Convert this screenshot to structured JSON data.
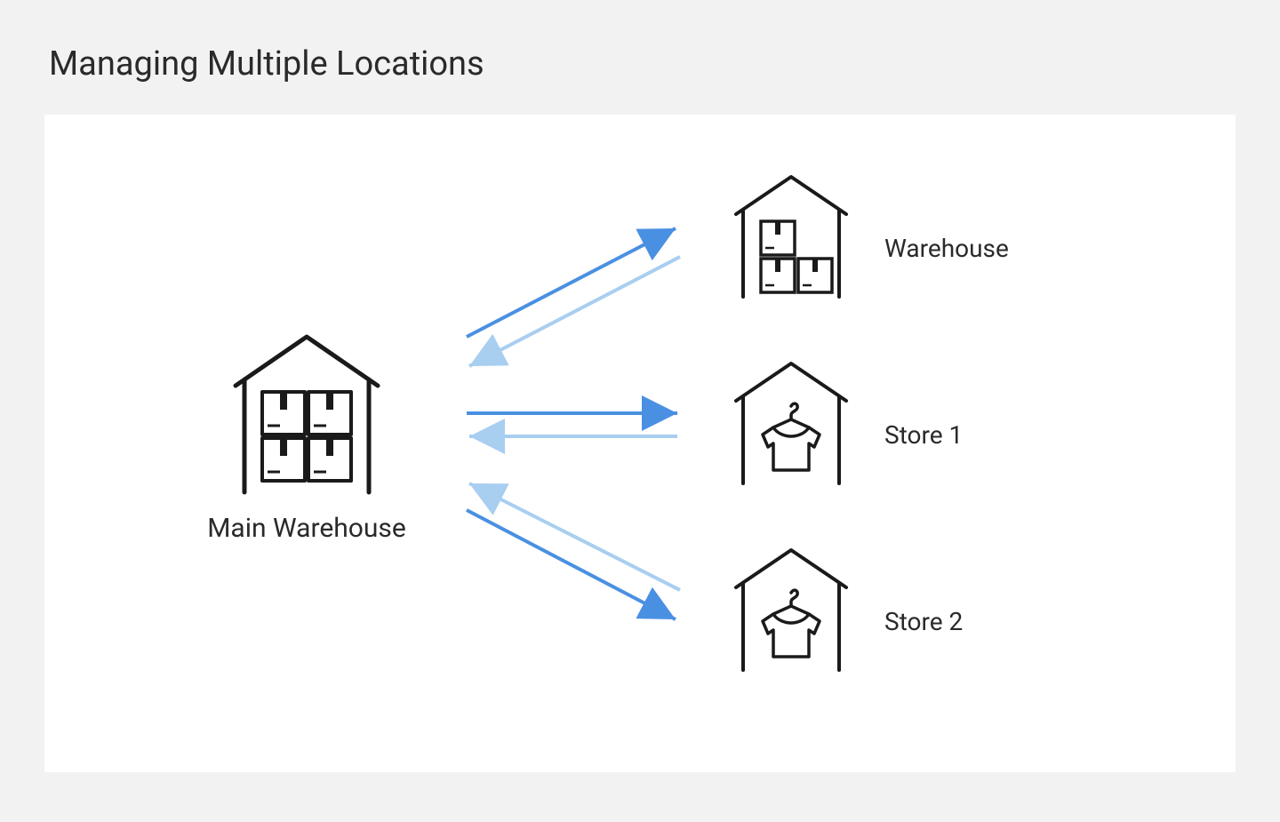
{
  "title": "Managing Multiple Locations",
  "nodes": {
    "main": {
      "label": "Main Warehouse"
    },
    "warehouse": {
      "label": "Warehouse"
    },
    "store1": {
      "label": "Store 1"
    },
    "store2": {
      "label": "Store 2"
    }
  },
  "arrows": {
    "color_forward": "#4a90e2",
    "color_backward": "#a8cef0"
  }
}
